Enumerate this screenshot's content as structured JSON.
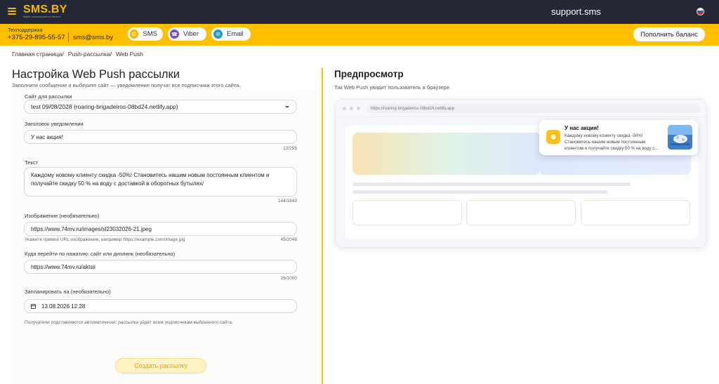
{
  "header": {
    "logo": "SMS.BY",
    "logo_sub": "digital communications service",
    "support_site": "support.sms"
  },
  "contact_bar": {
    "support_label": "Техподдержка",
    "phone": "+375-29-895-55-57",
    "email": "sms@sms.by",
    "channels": [
      {
        "label": "SMS",
        "icon": "sms-icon",
        "color": "#ffbf00"
      },
      {
        "label": "Viber",
        "icon": "viber-icon",
        "color": "#7b4fc8"
      },
      {
        "label": "Email",
        "icon": "email-icon",
        "color": "#1f9bd1"
      }
    ],
    "topup_label": "Пополнить баланс"
  },
  "breadcrumb": [
    "Главная страница/",
    "Push-рассылка/",
    "Web Push"
  ],
  "form": {
    "title": "Настройка Web Push рассылки",
    "subtitle": "Заполните сообщение и выберите сайт — уведомление получат все подписчики этого сайта.",
    "site": {
      "label": "Сайт для рассылки",
      "value": "test 09/08/2028 (roaring-brigadeiros-08bd24.netlify.app)"
    },
    "heading": {
      "label": "Заголовок уведомления",
      "value": "У нас акция!",
      "counter": "12/255"
    },
    "text": {
      "label": "Текст",
      "value": "Каждому новому клиенту скидка -50%! Становитесь нашим новым постоянным клиентом и получайте скидку 50 % на воду с доставкой в оборотных бутылях/",
      "counter": "144/1843"
    },
    "image": {
      "label": "Изображение (необязательно)",
      "value": "https://www.74mv.ru/images/sl23032026-21.jpeg",
      "hint": "Укажите прямой URL изображения, например https://example.com/image.jpg",
      "counter": "45/2048"
    },
    "link": {
      "label": "Куда перейти по нажатию: сайт или диплинк (необязательно)",
      "value": "https://www.74mv.ru/aktsii",
      "counter": "26/1000"
    },
    "schedule": {
      "label": "Запланировать на (необязательно)",
      "value": "13.08.2026 12:28"
    },
    "recipients_note": "Получатели подставляются автоматически: рассылка уйдёт всем подписчикам выбранного сайта.",
    "submit_label": "Создать рассылку"
  },
  "preview": {
    "title": "Предпросмотр",
    "subtitle": "Так Web Push увидит пользователь в браузере.",
    "url": "https://roaring-brigadeiros-08bd24.netlify.app",
    "notification": {
      "title": "У нас акция!",
      "body": "Каждому новому клиенту скидка -50%! Становитесь нашим новым постоянным клиентом и получайте скидку 50 % на воду с…"
    }
  },
  "colors": {
    "accent": "#ffbf00",
    "topbar": "#252837"
  }
}
